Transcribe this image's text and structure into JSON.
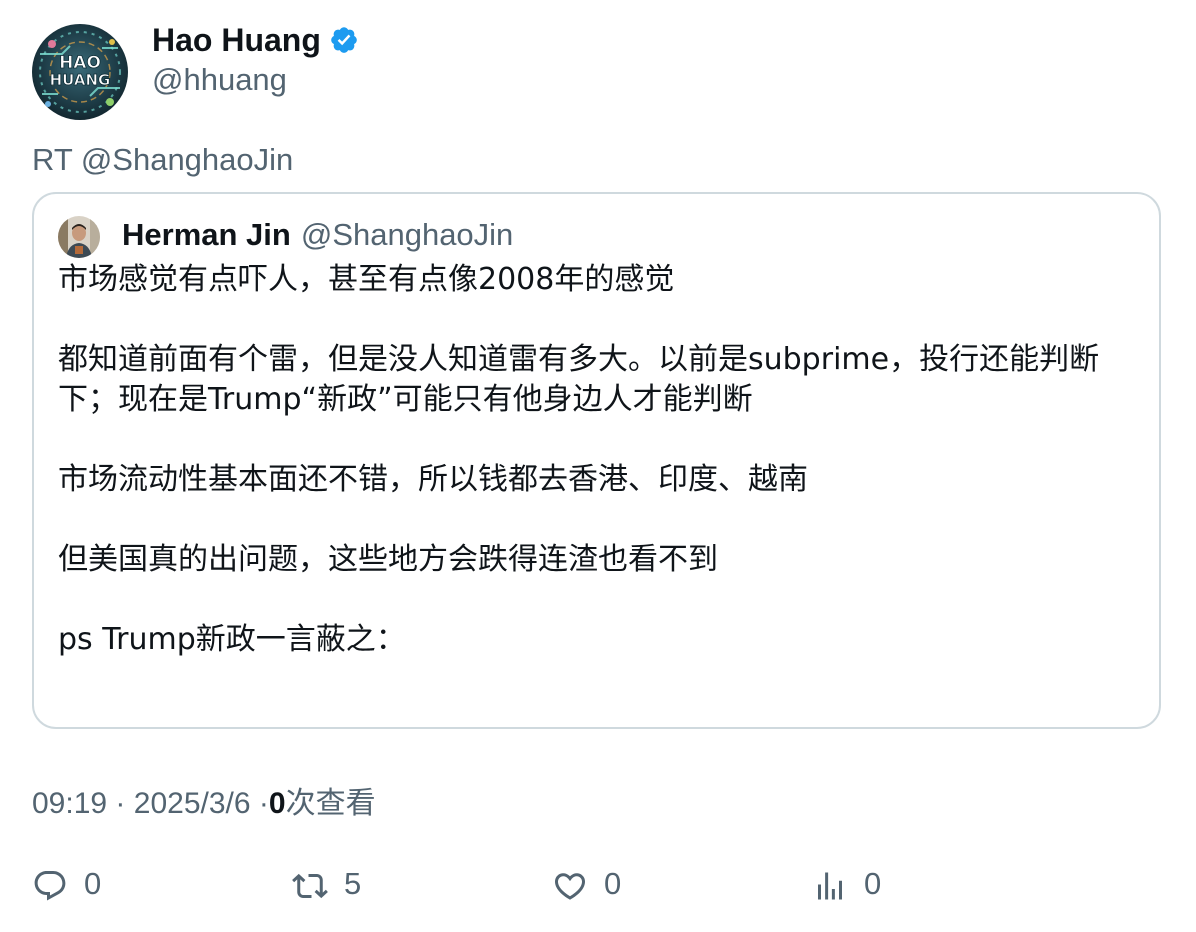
{
  "author": {
    "display_name": "Hao Huang",
    "handle": "@hhuang",
    "verified": true,
    "avatar_text_top": "HAO",
    "avatar_text_bottom": "HUANG"
  },
  "retweet_line": "RT @ShanghaoJin",
  "quoted_tweet": {
    "display_name": "Herman Jin",
    "handle": "@ShanghaoJin",
    "paragraphs": [
      "市场感觉有点吓人，甚至有点像2008年的感觉",
      "都知道前面有个雷，但是没人知道雷有多大。以前是subprime，投行还能判断下；现在是Trump“新政”可能只有他身边人才能判断",
      "市场流动性基本面还不错，所以钱都去香港、印度、越南",
      "但美国真的出问题，这些地方会跌得连渣也看不到",
      "ps Trump新政一言蔽之："
    ]
  },
  "meta": {
    "time": "09:19",
    "separator": "·",
    "date": "2025/3/6",
    "views_count": "0",
    "views_label": "次查看"
  },
  "actions": {
    "reply": {
      "icon": "reply-icon",
      "count": "0"
    },
    "retweet": {
      "icon": "retweet-icon",
      "count": "5"
    },
    "like": {
      "icon": "heart-icon",
      "count": "0"
    },
    "views": {
      "icon": "analytics-icon",
      "count": "0"
    }
  },
  "colors": {
    "text_primary": "#0f1419",
    "text_secondary": "#536471",
    "border": "#cfd9de",
    "verified_blue": "#1d9bf0"
  }
}
